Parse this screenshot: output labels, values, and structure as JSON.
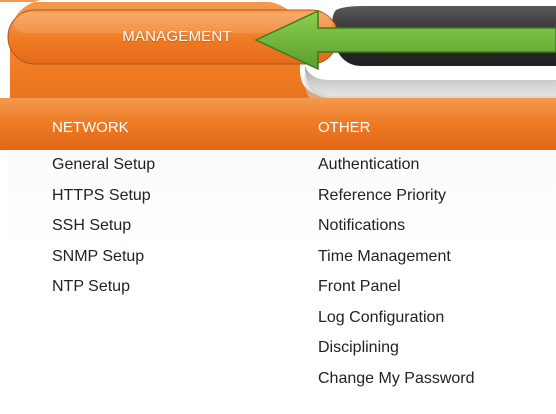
{
  "header": {
    "active_tab": "MANAGEMENT"
  },
  "columns": {
    "network": {
      "header": "NETWORK",
      "items": [
        "General Setup",
        "HTTPS Setup",
        "SSH Setup",
        "SNMP Setup",
        "NTP Setup"
      ]
    },
    "other": {
      "header": "OTHER",
      "items": [
        "Authentication",
        "Reference Priority",
        "Notifications",
        "Time Management",
        "Front Panel",
        "Log Configuration",
        "Disciplining",
        "Change My Password"
      ]
    }
  },
  "colors": {
    "brand_orange": "#ee7a22",
    "dark_tab": "#3a3a3a",
    "arrow_green": "#6cb33f"
  },
  "icons": {
    "pointer": "green-arrow-icon"
  }
}
